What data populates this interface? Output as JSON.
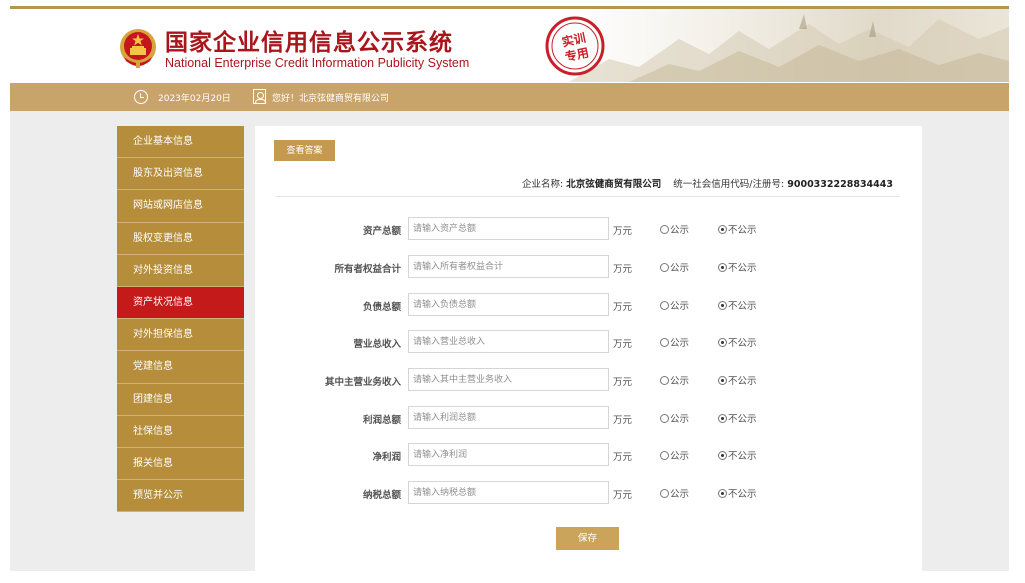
{
  "header": {
    "title_cn": "国家企业信用信息公示系统",
    "title_en": "National Enterprise Credit Information Publicity System",
    "stamp_text": "实训专用"
  },
  "info_bar": {
    "date": "2023年02月20日",
    "greeting": "您好！北京弦健商贸有限公司"
  },
  "sidebar": {
    "items": [
      {
        "label": "企业基本信息"
      },
      {
        "label": "股东及出资信息"
      },
      {
        "label": "网站或网店信息"
      },
      {
        "label": "股权变更信息"
      },
      {
        "label": "对外投资信息"
      },
      {
        "label": "资产状况信息",
        "active": true
      },
      {
        "label": "对外担保信息"
      },
      {
        "label": "党建信息"
      },
      {
        "label": "团建信息"
      },
      {
        "label": "社保信息"
      },
      {
        "label": "报关信息"
      },
      {
        "label": "预览并公示"
      }
    ]
  },
  "main": {
    "answer_button": "查看答案",
    "company_label": "企业名称:",
    "company_name": "北京弦健商贸有限公司",
    "code_label": "统一社会信用代码/注册号:",
    "code_value": "9000332228834443",
    "unit": "万元",
    "public_label": "公示",
    "nonpublic_label": "不公示",
    "fields": [
      {
        "label": "资产总额",
        "placeholder": "请输入资产总额"
      },
      {
        "label": "所有者权益合计",
        "placeholder": "请输入所有者权益合计"
      },
      {
        "label": "负债总额",
        "placeholder": "请输入负债总额"
      },
      {
        "label": "营业总收入",
        "placeholder": "请输入营业总收入"
      },
      {
        "label": "其中主营业务收入",
        "placeholder": "请输入其中主营业务收入"
      },
      {
        "label": "利润总额",
        "placeholder": "请输入利润总额"
      },
      {
        "label": "净利润",
        "placeholder": "请输入净利润"
      },
      {
        "label": "纳税总额",
        "placeholder": "请输入纳税总额"
      }
    ],
    "selected_option": "不公示",
    "save_button": "保存"
  },
  "colors": {
    "brand_red": "#a8161b",
    "gold": "#c9a46a",
    "sidebar_gold": "#b58d3b",
    "active_red": "#c41a1a"
  }
}
